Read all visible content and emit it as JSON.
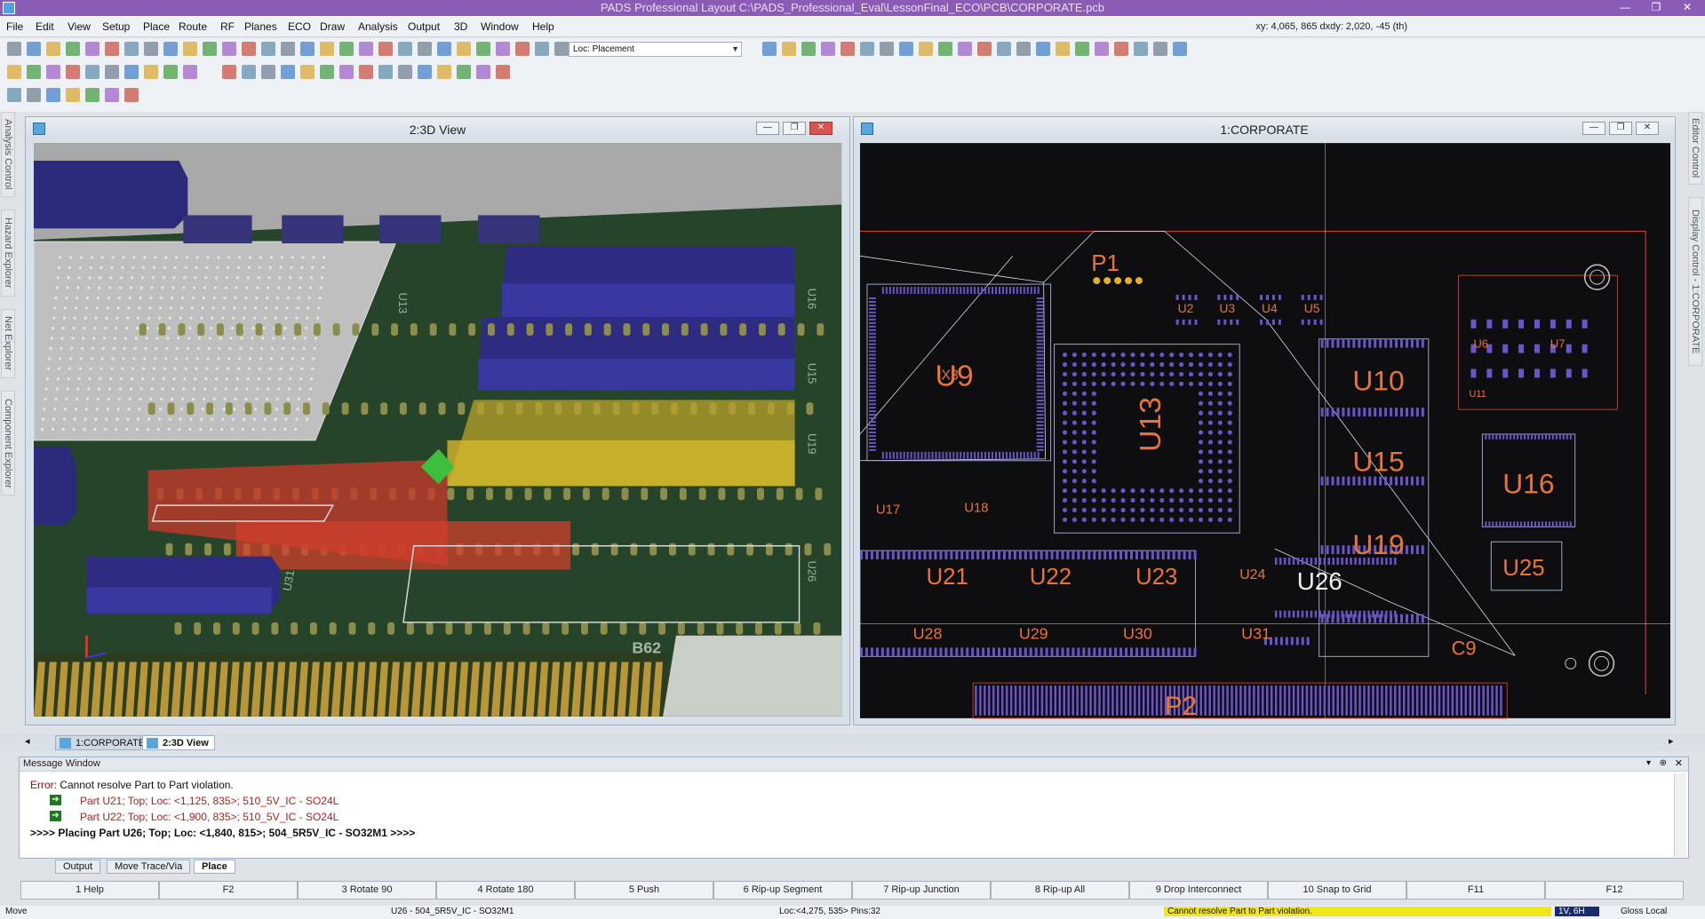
{
  "window": {
    "title": "PADS Professional Layout  C:\\PADS_Professional_Eval\\LessonFinal_ECO\\PCB\\CORPORATE.pcb",
    "min_symbol": "—",
    "max_symbol": "❐",
    "close_symbol": "✕"
  },
  "menu": [
    "File",
    "Edit",
    "View",
    "Setup",
    "Place",
    "Route",
    "RF",
    "Planes",
    "ECO",
    "Draw",
    "Analysis",
    "Output",
    "3D",
    "Window",
    "Help"
  ],
  "coords": "xy: 4,065, 865  dxdy: 2,020, -45  (th)",
  "toolbar": {
    "loc_select": "Loc: Placement"
  },
  "side_tabs_left": [
    "Analysis Control",
    "Hazard Explorer",
    "Net Explorer",
    "Component Explorer"
  ],
  "side_tabs_right": [
    "Editor Control",
    "Display Control - 1:CORPORATE"
  ],
  "view3d": {
    "title": "2:3D View",
    "labels": [
      "U13",
      "U16",
      "U15",
      "U19",
      "U26",
      "U31",
      "B62"
    ]
  },
  "pcb": {
    "title": "1:CORPORATE",
    "components": [
      {
        "ref": "P1"
      },
      {
        "ref": "U2"
      },
      {
        "ref": "U3"
      },
      {
        "ref": "U4"
      },
      {
        "ref": "U5"
      },
      {
        "ref": "U9"
      },
      {
        "ref": "U13"
      },
      {
        "ref": "U10"
      },
      {
        "ref": "U15"
      },
      {
        "ref": "U19"
      },
      {
        "ref": "U16"
      },
      {
        "ref": "U6"
      },
      {
        "ref": "U7"
      },
      {
        "ref": "U11"
      },
      {
        "ref": "U17"
      },
      {
        "ref": "U18"
      },
      {
        "ref": "U21"
      },
      {
        "ref": "U22"
      },
      {
        "ref": "U23"
      },
      {
        "ref": "U24"
      },
      {
        "ref": "U26"
      },
      {
        "ref": "U25"
      },
      {
        "ref": "U28"
      },
      {
        "ref": "U29"
      },
      {
        "ref": "U30"
      },
      {
        "ref": "U31"
      },
      {
        "ref": "C9"
      },
      {
        "ref": "P2"
      },
      {
        "ref": "X3"
      }
    ]
  },
  "doc_tabs": [
    "1:CORPORATE",
    "2:3D View"
  ],
  "message_window": {
    "title": "Message Window",
    "error_label": "Error:",
    "error_text": " Cannot resolve Part to Part violation.",
    "lines": [
      "Part U21; Top; Loc: <1,125, 835>; 510_5V_IC - SO24L",
      "Part U22; Top; Loc: <1,900, 835>; 510_5V_IC - SO24L"
    ],
    "placing": ">>>> Placing Part U26; Top; Loc: <1,840, 815>; 504_5R5V_IC - SO32M1 >>>>"
  },
  "message_tabs": [
    "Output",
    "Move Trace/Via",
    "Place"
  ],
  "fkeys": [
    "1 Help",
    "F2",
    "3 Rotate 90",
    "4 Rotate 180",
    "5 Push",
    "6 Rip-up Segment",
    "7 Rip-up Junction",
    "8 Rip-up All",
    "9 Drop Interconnect",
    "10 Snap to Grid",
    "F11",
    "F12"
  ],
  "status": {
    "mode": "Move",
    "part": "U26 - 504_5R5V_IC - SO32M1",
    "loc": "Loc:<4,275, 535> Pins:32",
    "error": "Cannot resolve Part to Part violation.",
    "layer": "1V, 6H",
    "gloss": "Gloss Local"
  },
  "colors": {
    "title_bar": "#8a5cb5",
    "pcb_background": "#0e0e10",
    "pcb_outline": "#c83a2a",
    "pcb_label": "#e8743a",
    "pad": "#6a55c8",
    "board_3d": "#1f3b1c",
    "component_3d": "#35347a"
  }
}
